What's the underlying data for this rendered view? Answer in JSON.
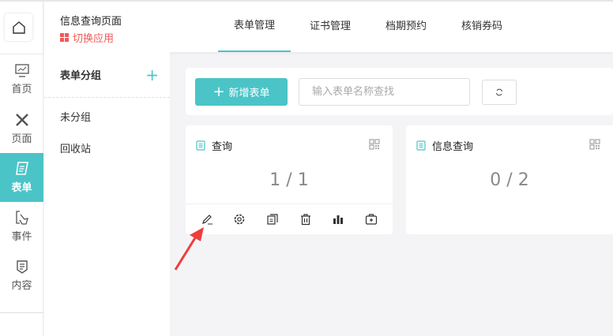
{
  "header": {
    "app_title": "信息查询页面",
    "switch_app": "切换应用",
    "tabs": [
      {
        "label": "表单管理",
        "active": true
      },
      {
        "label": "证书管理"
      },
      {
        "label": "档期预约"
      },
      {
        "label": "核销券码"
      }
    ]
  },
  "rail": {
    "items": [
      {
        "label": "首页",
        "icon": "monitor-icon"
      },
      {
        "label": "页面",
        "icon": "design-tools-icon"
      },
      {
        "label": "表单",
        "icon": "form-icon",
        "active": true
      },
      {
        "label": "事件",
        "icon": "touch-icon"
      },
      {
        "label": "内容",
        "icon": "content-shield-icon"
      }
    ]
  },
  "groups": {
    "title": "表单分组",
    "items": [
      "未分组",
      "回收站"
    ]
  },
  "toolbar": {
    "add_label": "新增表单",
    "search_placeholder": "输入表单名称查找"
  },
  "cards": [
    {
      "title": "查询",
      "count": "1 / 1"
    },
    {
      "title": "信息查询",
      "count": "0 / 2"
    }
  ],
  "colors": {
    "accent": "#4bc4c7",
    "switch": "#f05a5a",
    "annotation_arrow": "#f03c3c"
  }
}
